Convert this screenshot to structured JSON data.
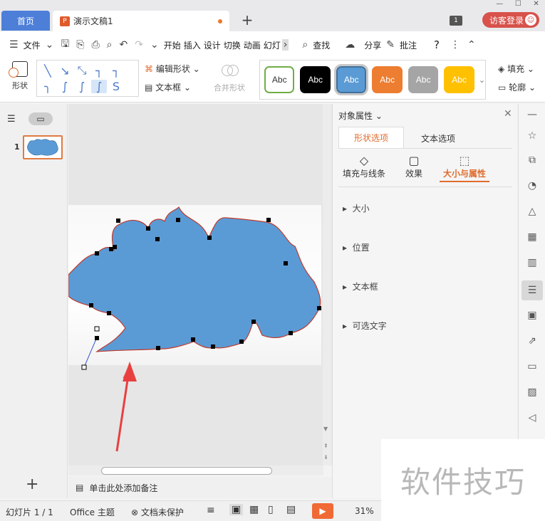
{
  "tabs": {
    "home": "首页",
    "doc": "演示文稿1",
    "new": "+"
  },
  "window": {
    "badge": "1",
    "login": "访客登录"
  },
  "menu": {
    "file": "文件",
    "items": [
      "开始",
      "插入",
      "设计",
      "切换",
      "动画",
      "幻灯"
    ],
    "find": "查找",
    "share": "分享",
    "comment": "批注",
    "help": "?"
  },
  "ribbon": {
    "shape": "形状",
    "edit_shape": "编辑形状",
    "textbox": "文本框",
    "merge_shape": "合并形状",
    "styles": [
      {
        "label": "Abc",
        "bg": "#ffffff",
        "fg": "#333333",
        "border": "#70ad47"
      },
      {
        "label": "Abc",
        "bg": "#000000",
        "fg": "#ffffff",
        "border": "#000000"
      },
      {
        "label": "Abc",
        "bg": "#5b9bd5",
        "fg": "#ffffff",
        "border": "#41719c"
      },
      {
        "label": "Abc",
        "bg": "#ed7d31",
        "fg": "#ffffff",
        "border": "#ed7d31"
      },
      {
        "label": "Abc",
        "bg": "#a5a5a5",
        "fg": "#ffffff",
        "border": "#a5a5a5"
      },
      {
        "label": "Abc",
        "bg": "#ffc000",
        "fg": "#ffffff",
        "border": "#ffc000"
      }
    ],
    "fill": "填充",
    "outline": "轮廓"
  },
  "slides": {
    "number": "1"
  },
  "notes": {
    "placeholder": "单击此处添加备注"
  },
  "props": {
    "title": "对象属性",
    "tab_shape": "形状选项",
    "tab_text": "文本选项",
    "sub_fill": "填充与线条",
    "sub_effect": "效果",
    "sub_size": "大小与属性",
    "sections": [
      "大小",
      "位置",
      "文本框",
      "可选文字"
    ]
  },
  "status": {
    "slide": "幻灯片 1 / 1",
    "theme": "Office 主题",
    "protect": "文档未保护",
    "zoom": "31%"
  },
  "watermark": "软件技巧",
  "colors": {
    "accent": "#e06b2d",
    "shape_fill": "#5b9bd5",
    "shape_outline": "#c0392b",
    "home_tab": "#4d7fd9"
  }
}
